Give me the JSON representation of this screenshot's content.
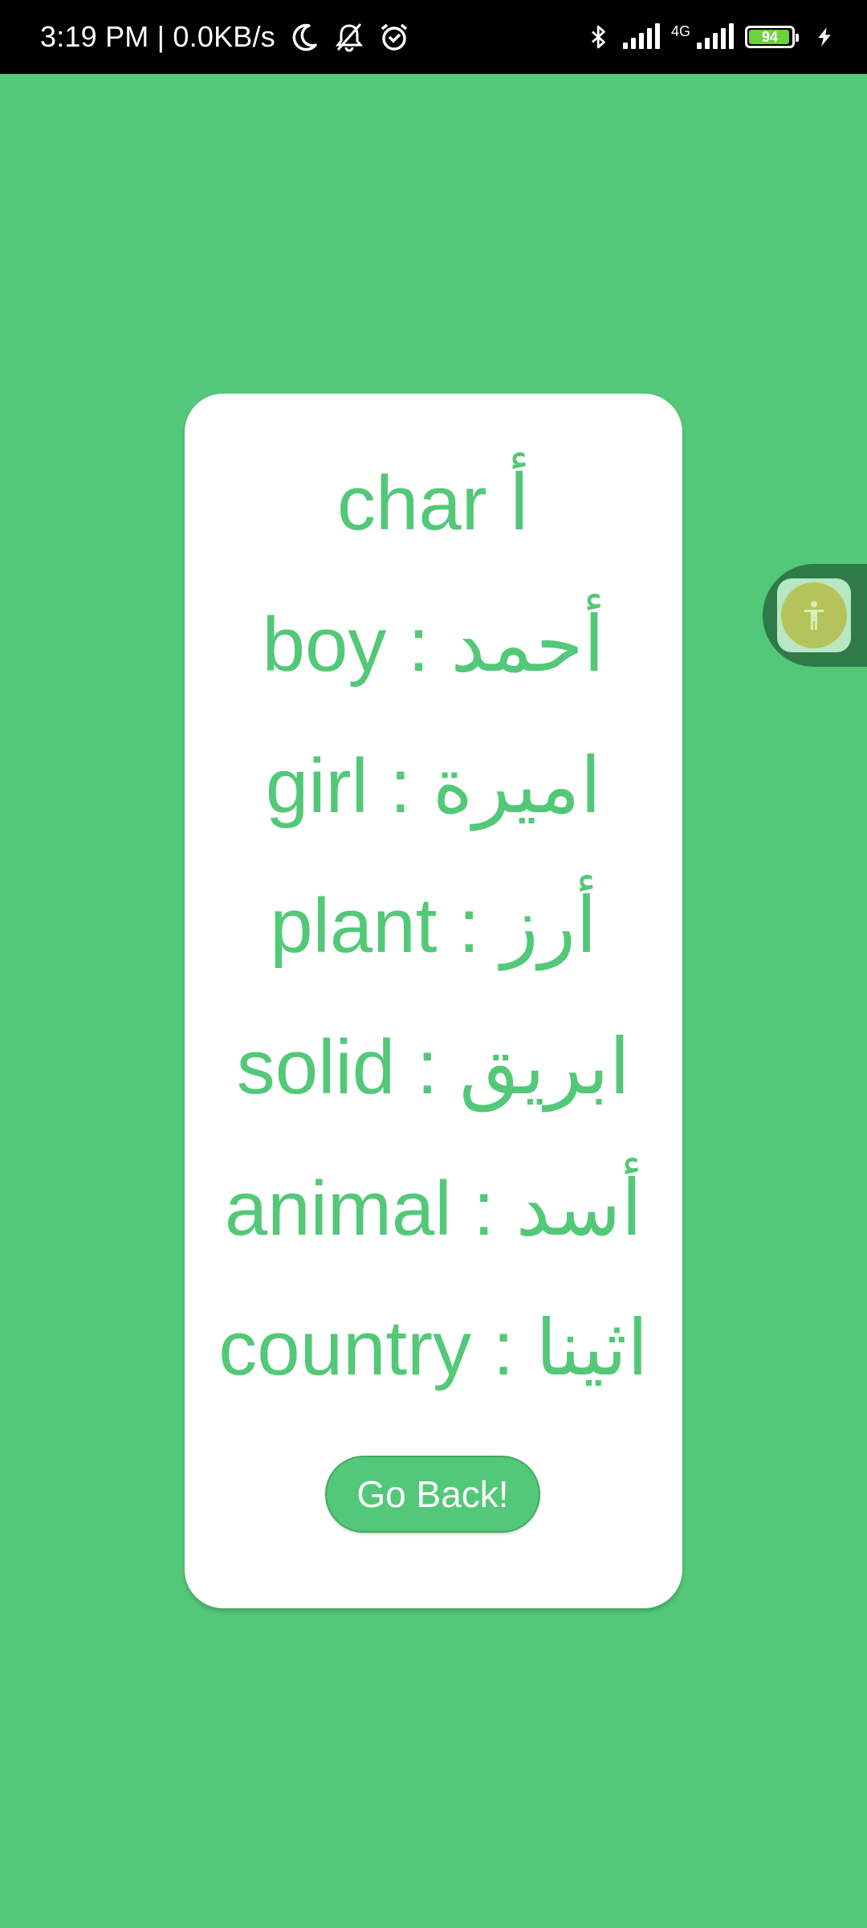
{
  "status_bar": {
    "time": "3:19 PM | 0.0KB/s",
    "network_type": "4G",
    "battery_level": "94",
    "icons": [
      "moon-icon",
      "bell-off-icon",
      "alarm-icon",
      "bluetooth-icon",
      "signal-icon",
      "signal-icon",
      "battery-icon",
      "charging-icon"
    ]
  },
  "card": {
    "lines": [
      "char أ",
      "boy : أحمد",
      "girl : اميرة",
      "plant : أرز",
      "solid : ابريق",
      "animal : أسد",
      "country : اثينا"
    ],
    "button_label": "Go Back!"
  },
  "accessibility": {
    "icon": "accessibility-icon"
  },
  "colors": {
    "background": "#53c878",
    "card": "#ffffff",
    "text": "#53c878",
    "button": "#53c878",
    "status_bar": "#000000",
    "a11y_tab": "#2f7a49"
  }
}
